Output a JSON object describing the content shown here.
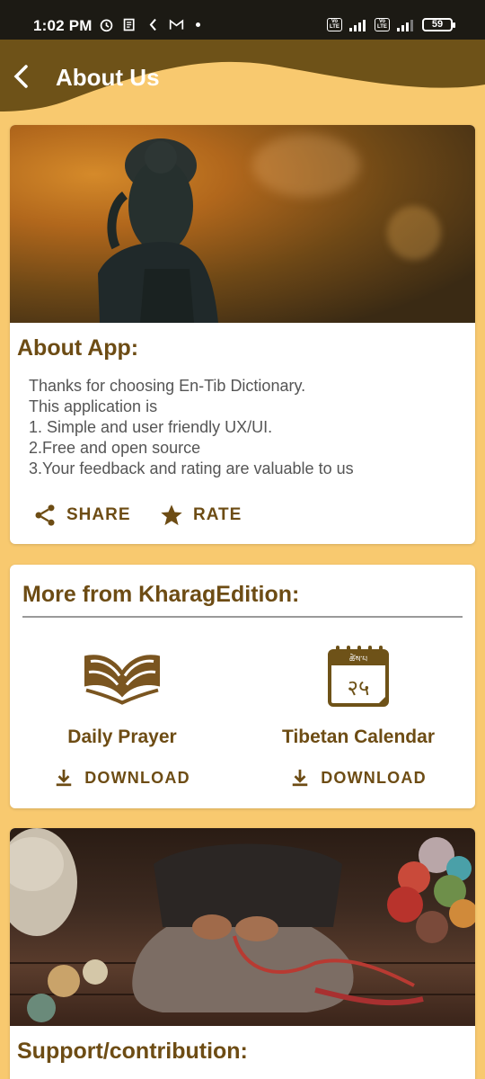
{
  "status_bar": {
    "time": "1:02 PM",
    "volte1": "Vo LTE",
    "volte2": "Vo LTE",
    "battery": "59"
  },
  "header": {
    "title": "About Us",
    "back_icon": "chevron-left-icon"
  },
  "colors": {
    "accent": "#6d4c14",
    "background": "#f8c96f",
    "header": "#6e5218"
  },
  "about": {
    "title": "About App:",
    "lines": [
      "Thanks for choosing En-Tib Dictionary.",
      "This application is",
      "1. Simple and user friendly UX/UI.",
      "2.Free and open source",
      "3.Your feedback and rating are valuable to us"
    ],
    "share_label": "SHARE",
    "rate_label": "RATE"
  },
  "more": {
    "title": "More from KharagEdition:",
    "apps": [
      {
        "name": "Daily Prayer",
        "download_label": "DOWNLOAD",
        "icon": "open-book-hands-icon"
      },
      {
        "name": "Tibetan Calendar",
        "download_label": "DOWNLOAD",
        "icon": "calendar-icon",
        "calendar_header": "ཚེས་པ",
        "calendar_day": "२५"
      }
    ]
  },
  "support": {
    "title": "Support/contribution:"
  }
}
